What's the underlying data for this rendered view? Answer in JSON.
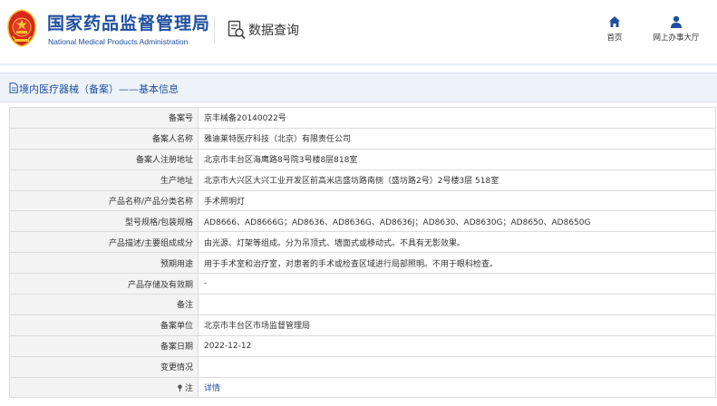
{
  "header": {
    "site_title": "国家药品监督管理局",
    "site_subtitle": "National Medical Products Administration",
    "query_title": "数据查询",
    "nav": {
      "home_label": "首页",
      "office_label": "网上办事大厅"
    },
    "icons": {
      "emblem": "national-emblem-icon",
      "query": "data-query-icon",
      "home": "home-icon",
      "office": "user-icon"
    }
  },
  "section": {
    "title": "境内医疗器械（备案）——基本信息"
  },
  "record": {
    "rows": [
      {
        "label": "备案号",
        "value": "京丰械备20140022号"
      },
      {
        "label": "备案人名称",
        "value": "雅迪莱特医疗科技（北京）有限责任公司"
      },
      {
        "label": "备案人注册地址",
        "value": "北京市丰台区海鹰路8号院3号楼8层818室"
      },
      {
        "label": "生产地址",
        "value": "北京市大兴区大兴工业开发区前高米店盛坊路南侧（盛坊路2号）2号楼3层 518室"
      },
      {
        "label": "产品名称/产品分类名称",
        "value": "手术照明灯"
      },
      {
        "label": "型号规格/包装规格",
        "value": "AD8666、AD8666G；AD8636、AD8636G、AD8636J；AD8630、AD8630G；AD8650、AD8650G"
      },
      {
        "label": "产品描述/主要组成成分",
        "value": "由光源、灯架等组成。分为吊顶式、墙面式或移动式。不具有无影效果。"
      },
      {
        "label": "预期用途",
        "value": "用于手术室和治疗室，对患者的手术或检查区域进行局部照明。不用于眼科检查。"
      },
      {
        "label": "产品存储及有效期",
        "value": "-"
      },
      {
        "label": "备注",
        "value": ""
      },
      {
        "label": "备案单位",
        "value": "北京市丰台区市场监督管理局"
      },
      {
        "label": "备案日期",
        "value": "2022-12-12"
      },
      {
        "label": "变更情况",
        "value": ""
      }
    ],
    "note_label": "注",
    "note_link": "详情"
  },
  "colors": {
    "brand_blue": "#1f4fa0",
    "emblem_red": "#d8261c",
    "emblem_gold": "#f2c230",
    "section_bg": "#eef3fa",
    "label_bg": "#f3f3f3",
    "border": "#dcdcdc"
  }
}
